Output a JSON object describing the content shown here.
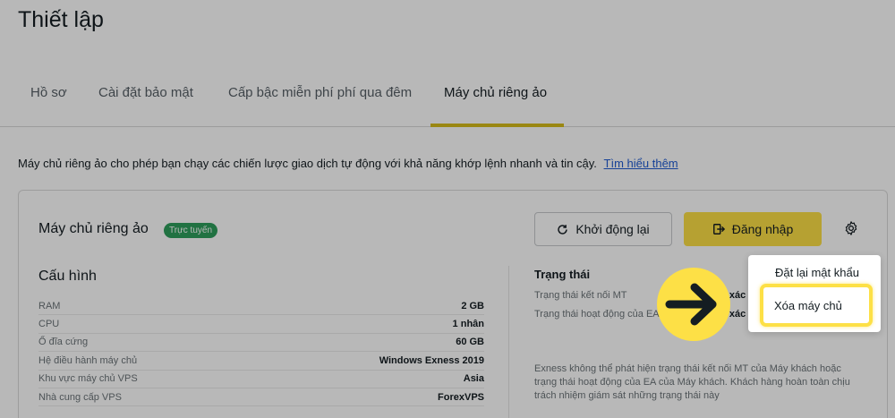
{
  "page": {
    "title": "Thiết lập"
  },
  "tabs": [
    {
      "label": "Hồ sơ",
      "active": false
    },
    {
      "label": "Cài đặt bảo mật",
      "active": false
    },
    {
      "label": "Cấp bậc miễn phí phí qua đêm",
      "active": false
    },
    {
      "label": "Máy chủ riêng ảo",
      "active": true
    }
  ],
  "description": {
    "text": "Máy chủ riêng ảo cho phép bạn chạy các chiến lược giao dịch tự động với khả năng khớp lệnh nhanh và tin cậy.",
    "link": "Tìm hiểu thêm"
  },
  "vps": {
    "title": "Máy chủ riêng ảo",
    "badge": "Trực tuyến",
    "restart_label": "Khởi động lại",
    "login_label": "Đăng nhập",
    "config": {
      "title": "Cấu hình",
      "rows": [
        {
          "key": "RAM",
          "value": "2 GB"
        },
        {
          "key": "CPU",
          "value": "1 nhân"
        },
        {
          "key": "Ổ đĩa cứng",
          "value": "60 GB"
        },
        {
          "key": "Hệ điều hành máy chủ",
          "value": "Windows Exness 2019"
        },
        {
          "key": "Khu vực máy chủ VPS",
          "value": "Asia"
        },
        {
          "key": "Nhà cung cấp VPS",
          "value": "ForexVPS"
        }
      ]
    },
    "status": {
      "title": "Trạng thái",
      "mt_label": "Trạng thái kết nối MT",
      "mt_value": "Không xác định",
      "ea_label": "Trạng thái hoạt động của EA",
      "ea_value": "Không xác định",
      "note": "Exness không thể phát hiện trạng thái kết nối MT của Máy khách hoặc trạng thái hoạt động của EA của Máy khách. Khách hàng hoàn toàn chịu trách nhiệm giám sát những trạng thái này"
    }
  },
  "menu": {
    "reset_password": "Đặt lại mật khẩu",
    "delete_server": "Xóa máy chủ"
  },
  "colors": {
    "accent": "#fde046",
    "badge": "#2f9e5c",
    "link": "#1f5bd1"
  },
  "icons": [
    "refresh-icon",
    "login-icon",
    "gear-icon",
    "arrow-right-icon"
  ]
}
